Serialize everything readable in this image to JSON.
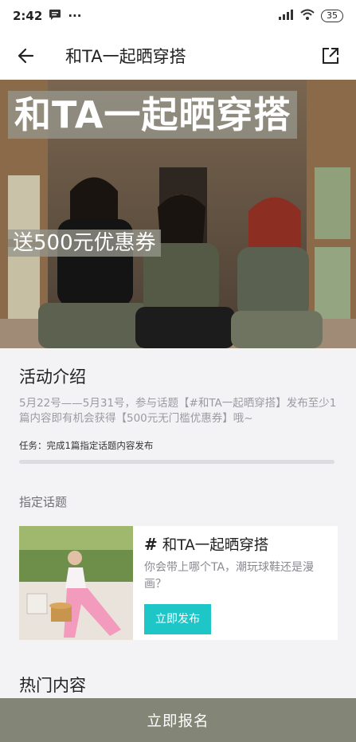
{
  "status_bar": {
    "time": "2:42",
    "dots": "···",
    "battery": "35"
  },
  "nav": {
    "title": "和TA一起晒穿搭"
  },
  "banner": {
    "title": "和TA一起晒穿搭",
    "subtitle": "送500元优惠券"
  },
  "intro": {
    "title": "活动介绍",
    "desc": "5月22号——5月31号，参与话题【#和TA一起晒穿搭】发布至少1篇内容即有机会获得【500元无门槛优惠券】哦~",
    "task": "任务：完成1篇指定话题内容发布",
    "progress": 0
  },
  "topic": {
    "section_label": "指定话题",
    "hash": "#",
    "name": "和TA一起晒穿搭",
    "desc": "你会带上哪个TA，潮玩球鞋还是漫画？",
    "button": "立即发布"
  },
  "hot": {
    "title": "热门内容"
  },
  "cta": {
    "label": "立即报名"
  },
  "colors": {
    "cta_bg": "#838677",
    "publish_btn": "#1fc6c8"
  }
}
